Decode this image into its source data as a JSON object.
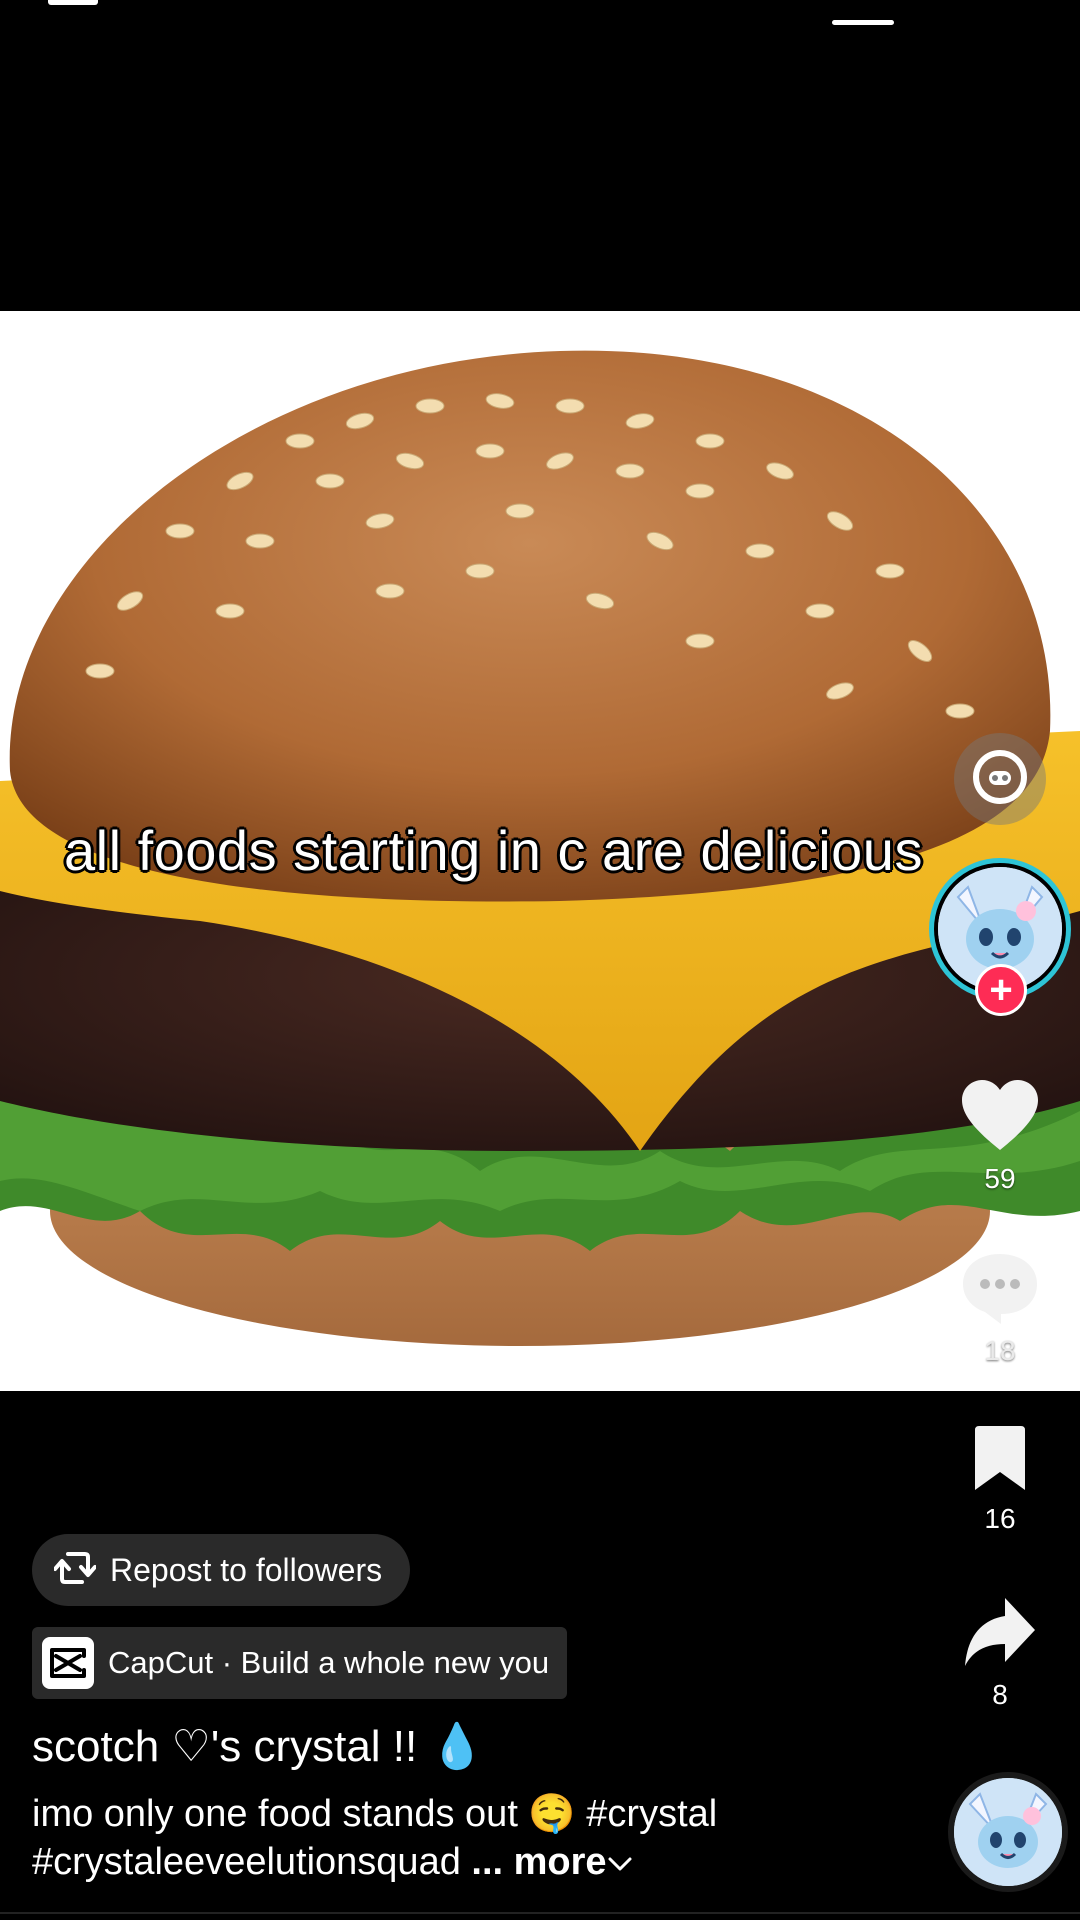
{
  "video": {
    "overlay_text": "all foods starting in c are delicious"
  },
  "actions": {
    "likes": "59",
    "comments": "18",
    "saves": "16",
    "shares": "8"
  },
  "repost": {
    "label": "Repost to followers"
  },
  "capcut": {
    "label": "CapCut · Build a whole new you"
  },
  "post": {
    "username": "scotch ♡'s crystal !! 💧",
    "description": "imo only one food stands out 🤤 #crystal #crystaleeveelutionsquad",
    "more_label": "... more"
  },
  "colors": {
    "follow_plus": "#fe2c55",
    "avatar_ring": "#2ec4d6",
    "pill_bg": "#2a2a2a"
  },
  "icons": [
    "filter-icon",
    "heart-icon",
    "comment-icon",
    "bookmark-icon",
    "share-icon",
    "repost-icon",
    "capcut-icon",
    "chevron-down-icon"
  ]
}
